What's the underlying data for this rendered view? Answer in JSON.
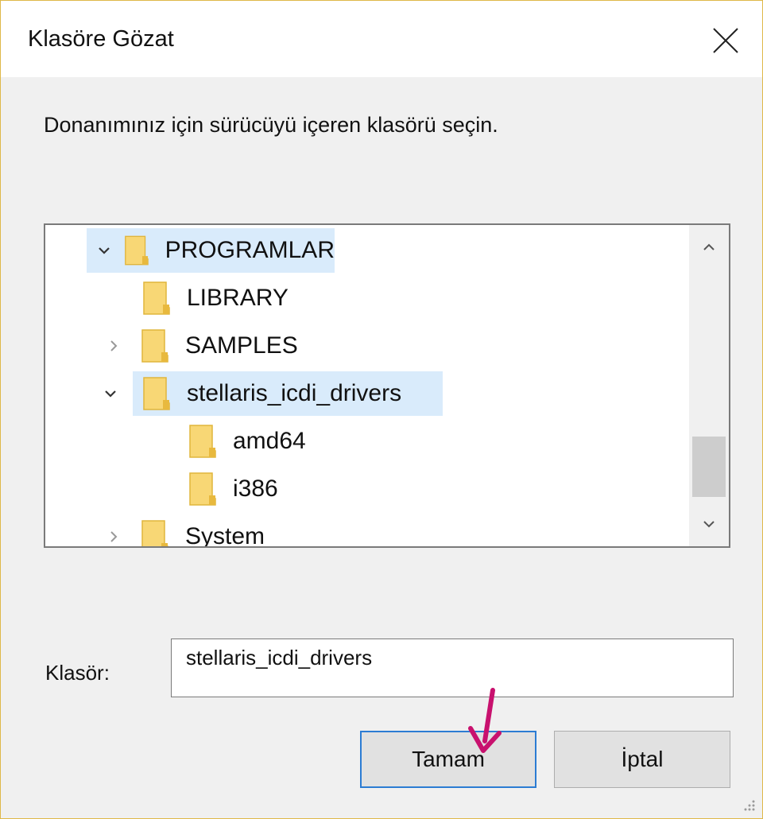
{
  "window": {
    "title": "Klasöre Gözat",
    "instruction": "Donanımınız için sürücüyü içeren klasörü seçin."
  },
  "tree": {
    "items": [
      {
        "label": "PROGRAMLAR",
        "expander": "chevron-down-icon",
        "selected": true
      },
      {
        "label": "LIBRARY",
        "expander": "none",
        "selected": false
      },
      {
        "label": "SAMPLES",
        "expander": "chevron-right-icon",
        "selected": false
      },
      {
        "label": "stellaris_icdi_drivers",
        "expander": "chevron-down-icon",
        "selected": true
      },
      {
        "label": "amd64",
        "expander": "none",
        "selected": false
      },
      {
        "label": "i386",
        "expander": "none",
        "selected": false
      },
      {
        "label": "System",
        "expander": "chevron-right-icon",
        "selected": false
      }
    ]
  },
  "folder_field": {
    "label": "Klasör:",
    "value": "stellaris_icdi_drivers"
  },
  "buttons": {
    "ok_label": "Tamam",
    "cancel_label": "İptal"
  },
  "colors": {
    "selection": "#d9ebfb",
    "folder": "#f8d775",
    "focus_border": "#2c7cd3",
    "annotation_arrow": "#c8116e"
  }
}
